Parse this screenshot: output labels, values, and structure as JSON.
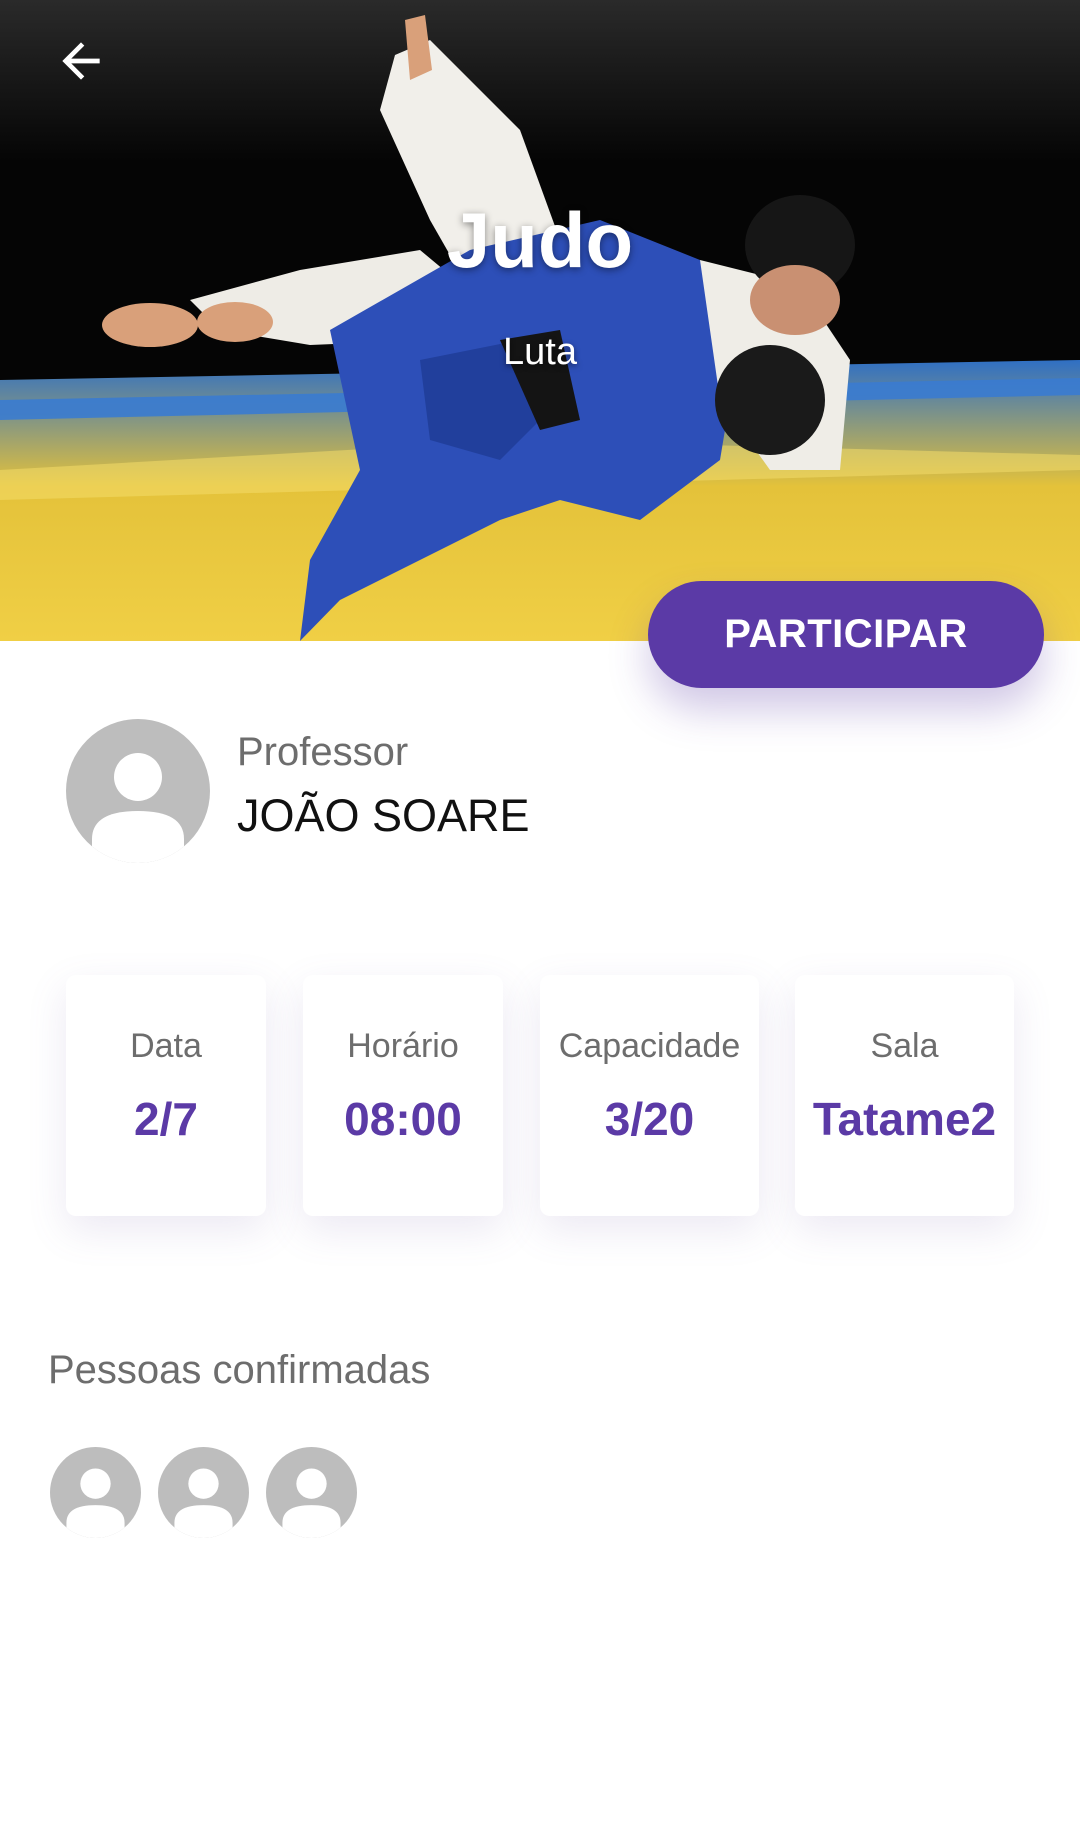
{
  "header": {
    "title": "Judo",
    "subtitle": "Luta",
    "back_icon": "arrow-left-icon",
    "hero_image": "judo-throw-photo"
  },
  "actions": {
    "participate_label": "PARTICIPAR"
  },
  "teacher": {
    "role_label": "Professor",
    "name": "JOÃO SOARE",
    "avatar_icon": "user-avatar-placeholder-icon"
  },
  "info_cards": [
    {
      "label": "Data",
      "value": "2/7"
    },
    {
      "label": "Horário",
      "value": "08:00"
    },
    {
      "label": "Capacidade",
      "value": "3/20"
    },
    {
      "label": "Sala",
      "value": "Tatame2"
    }
  ],
  "confirmed": {
    "title": "Pessoas confirmadas",
    "count": 3,
    "avatar_icon": "user-avatar-placeholder-icon"
  },
  "colors": {
    "accent": "#5b3aa6",
    "text_secondary": "#6d6d6d",
    "text_primary": "#111111",
    "avatar_bg": "#bdbdbd",
    "mat_yellow": "#e8c63a",
    "mat_blue": "#2f6fc4"
  }
}
